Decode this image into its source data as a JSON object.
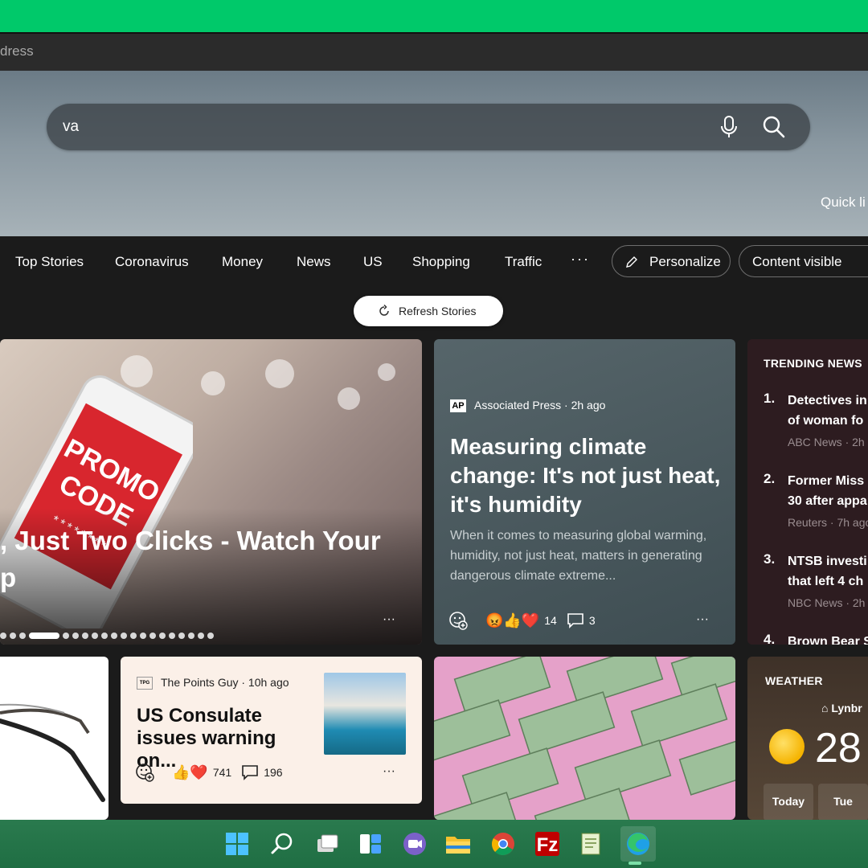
{
  "browser": {
    "address_placeholder": "dress"
  },
  "search": {
    "query": "va",
    "quick_links_label": "Quick li"
  },
  "nav": {
    "items": [
      "Top Stories",
      "Coronavirus",
      "Money",
      "News",
      "US",
      "Shopping",
      "Traffic"
    ],
    "more": "···",
    "personalize_label": "Personalize",
    "content_visibility_label": "Content visible"
  },
  "refresh_label": "Refresh Stories",
  "promo": {
    "line1": ", Just Two Clicks - Watch Your",
    "line2": "p",
    "more": "···",
    "slides": 20,
    "active_slide": 3
  },
  "climate": {
    "source": "Associated Press · 2h ago",
    "source_logo": "AP",
    "title": "Measuring climate change: It's not just heat, it's humidity",
    "summary": "When it comes to measuring global warming, humidity, not just heat, matters in generating dangerous climate extreme...",
    "reaction_count": "14",
    "comment_count": "3",
    "more": "···"
  },
  "trending": {
    "header": "TRENDING NEWS",
    "items": [
      {
        "num": "1.",
        "line1": "Detectives in",
        "line2": "of woman fo",
        "meta": "ABC News · 2h"
      },
      {
        "num": "2.",
        "line1": "Former Miss",
        "line2": "30 after appa",
        "meta": "Reuters · 7h ago"
      },
      {
        "num": "3.",
        "line1": "NTSB investi",
        "line2": "that left 4 ch",
        "meta": "NBC News · 2h"
      },
      {
        "num": "4.",
        "line1": "Brown Bear S",
        "line2": "",
        "meta": ""
      }
    ]
  },
  "points": {
    "source": "The Points Guy · 10h ago",
    "title": "US Consulate issues warning on...",
    "reaction_count": "741",
    "comment_count": "196",
    "more": "···"
  },
  "weather": {
    "header": "WEATHER",
    "location": "Lynbr",
    "temperature": "28",
    "days": [
      "Today",
      "Tue"
    ]
  },
  "taskbar": {
    "apps": [
      "start",
      "search",
      "task-view",
      "widgets",
      "teams-chat",
      "file-explorer",
      "chrome",
      "filezilla",
      "notepad",
      "edge"
    ]
  }
}
